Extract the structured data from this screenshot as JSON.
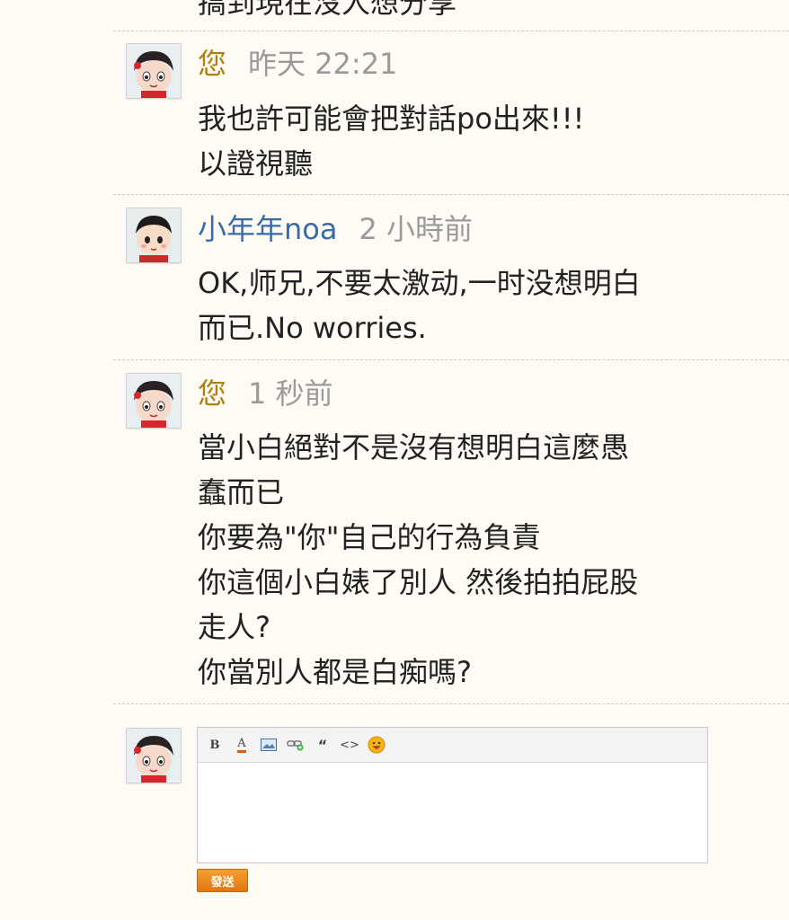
{
  "previous_tail": "搞到現在沒人想分享",
  "comments": [
    {
      "author": "您",
      "time": "昨天 22:21",
      "lines": [
        "我也許可能會把對話po出來!!!",
        "以證視聽"
      ]
    },
    {
      "author": "小年年noa",
      "time": "2 小時前",
      "lines": [
        "OK,师兄,不要太激动,一时没想明白",
        "而已.No worries."
      ]
    },
    {
      "author": "您",
      "time": "1 秒前",
      "lines": [
        "當小白絕對不是沒有想明白這麼愚",
        "蠢而已",
        "你要為\"你\"自己的行為負責",
        "你這個小白婊了別人 然後拍拍屁股",
        "走人?",
        "你當別人都是白痴嗎?"
      ]
    }
  ],
  "editor": {
    "toolbar": [
      "bold-icon",
      "font-color-icon",
      "image-icon",
      "link-icon",
      "quote-icon",
      "code-icon",
      "emoji-icon"
    ],
    "bold_label": "B",
    "font_color_label": "A",
    "quote_label": "“",
    "code_label": "<>",
    "value": "",
    "submit_label": "發送"
  },
  "colors": {
    "you_author": "#b07f10",
    "other_author": "#3a6aa8",
    "timestamp": "#9a9a9a",
    "send_button": "#e27610"
  }
}
